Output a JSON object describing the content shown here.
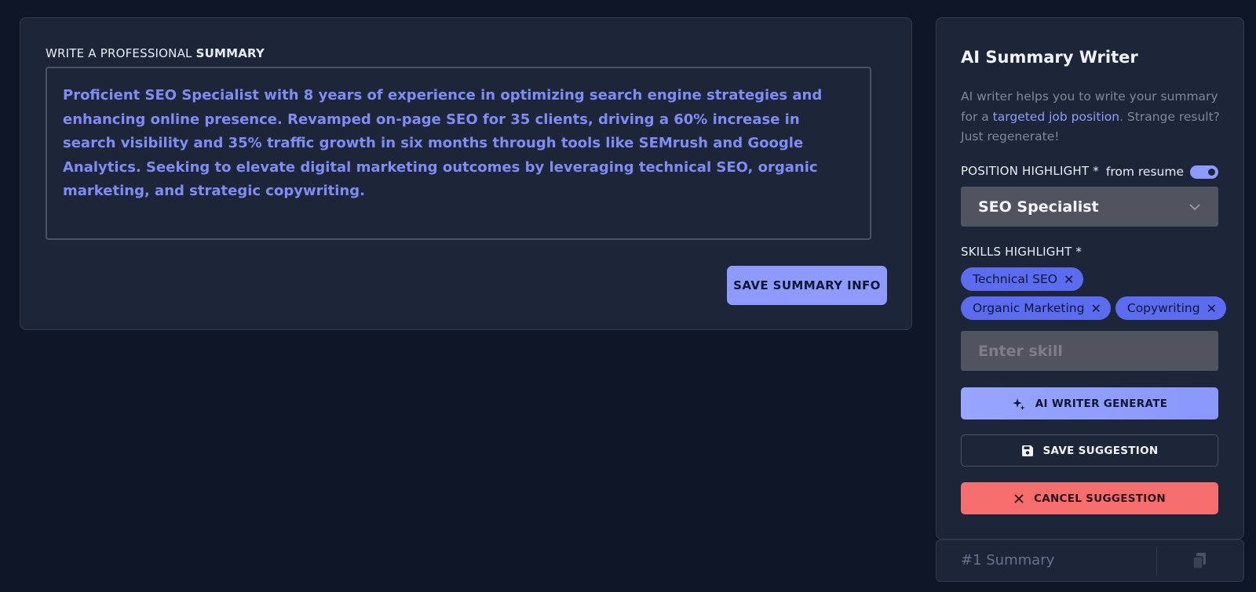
{
  "summary": {
    "label_prefix": "WRITE A PROFESSIONAL ",
    "label_bold": "SUMMARY",
    "text": "Proficient SEO Specialist with 8 years of experience in optimizing search engine strategies and enhancing online presence. Revamped on-page SEO for 35 clients, driving a 60% increase in search visibility and 35% traffic growth in six months through tools like SEMrush and Google Analytics. Seeking to elevate digital marketing outcomes by leveraging technical SEO, organic marketing, and strategic copywriting.",
    "save_label": "SAVE SUMMARY INFO"
  },
  "ai_writer": {
    "title": "AI Summary Writer",
    "desc_part1": "AI writer helps you to write your summary for a ",
    "desc_link": "targeted job position",
    "desc_part2": ". Strange result? Just regenerate!",
    "position_label": "POSITION HIGHLIGHT *",
    "toggle_label": "from resume",
    "toggle_on": true,
    "position_value": "SEO Specialist",
    "skills_label": "SKILLS HIGHLIGHT *",
    "skills": [
      "Technical SEO",
      "Organic Marketing",
      "Copywriting"
    ],
    "skill_placeholder": "Enter skill",
    "generate_label": "AI WRITER GENERATE",
    "save_suggestion_label": "SAVE SUGGESTION",
    "cancel_suggestion_label": "CANCEL SUGGESTION",
    "icons": {
      "generate": "sparkle-icon",
      "save": "floppy-disk-icon",
      "cancel": "close-icon",
      "chip_remove": "close-icon",
      "select": "chevron-down-icon"
    }
  },
  "summary_tab": {
    "label": "#1 Summary",
    "icon": "copy-icon"
  },
  "colors": {
    "background": "#0e1628",
    "card": "#1d2639",
    "accent": "#8e9bfd",
    "chip": "#5b6cf0",
    "danger": "#f56d6d"
  }
}
